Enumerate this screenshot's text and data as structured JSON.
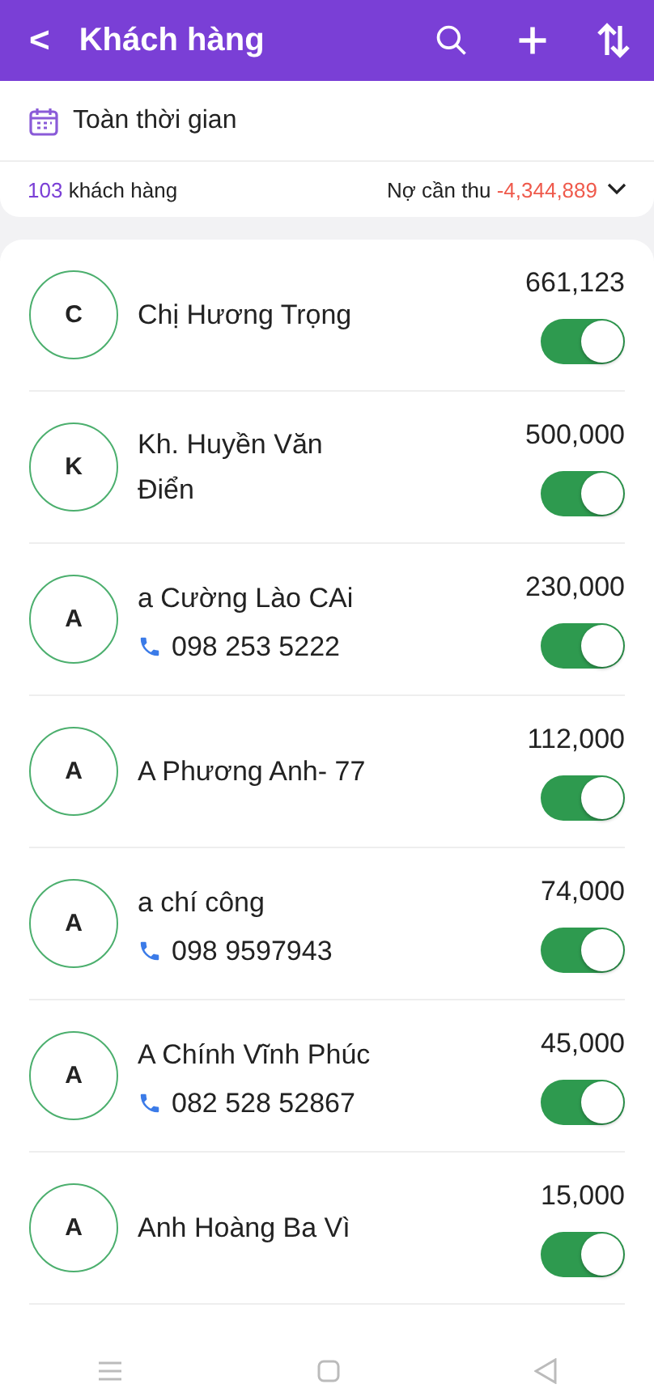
{
  "header": {
    "back": "<",
    "title": "Khách hàng"
  },
  "filter": {
    "label": "Toàn thời gian"
  },
  "summary": {
    "count": "103",
    "count_label": "khách hàng",
    "debt_label": "Nợ cần thu",
    "debt_value": "-4,344,889"
  },
  "customers": [
    {
      "initial": "C",
      "name": "Chị Hương Trọng",
      "amount": "661,123",
      "on": true
    },
    {
      "initial": "K",
      "name": "Kh. Huyền Văn Điển",
      "amount": "500,000",
      "on": true
    },
    {
      "initial": "A",
      "name": "a Cường Lào CAi",
      "phone": "098 253 5222",
      "amount": "230,000",
      "on": true
    },
    {
      "initial": "A",
      "name": "A Phương Anh- 77",
      "amount": "112,000",
      "on": true
    },
    {
      "initial": "A",
      "name": "a chí công",
      "phone": "098 9597943",
      "amount": "74,000",
      "on": true
    },
    {
      "initial": "A",
      "name": "A Chính Vĩnh Phúc",
      "phone": "082 528 52867",
      "amount": "45,000",
      "on": true
    },
    {
      "initial": "A",
      "name": "Anh Hoàng Ba Vì",
      "amount": "15,000",
      "on": true
    }
  ]
}
